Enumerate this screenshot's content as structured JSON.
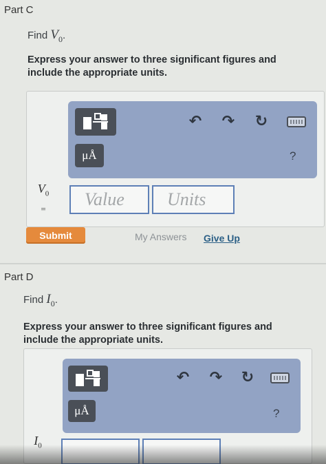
{
  "part_c": {
    "title": "Part C",
    "find_prefix": "Find",
    "find_var": "V",
    "find_sub": "0",
    "find_suffix": ".",
    "instruction_line1": "Express your answer to three significant figures and",
    "instruction_line2": "include the appropriate units.",
    "unit_symbol": "μÅ",
    "help": "?",
    "var": "V",
    "var_sub": "0",
    "equals": "=",
    "value_placeholder": "Value",
    "units_placeholder": "Units",
    "submit_label": "Submit",
    "my_answers_label": "My Answers",
    "give_up_label": "Give Up"
  },
  "part_d": {
    "title": "Part D",
    "find_prefix": "Find",
    "find_var": "I",
    "find_sub": "0",
    "find_suffix": ".",
    "instruction_line1": "Express your answer to three significant figures and",
    "instruction_line2": "include the appropriate units.",
    "unit_symbol": "μÅ",
    "help": "?",
    "var": "I",
    "var_sub": "0"
  },
  "icons": {
    "undo": "↶",
    "redo": "↷",
    "reset": "↻"
  },
  "colors": {
    "toolbar_bg": "#92a3c4",
    "tool_button": "#4a4f57",
    "submit": "#e58a3c",
    "input_border": "#5d7fb6",
    "link": "#2b5f86"
  }
}
